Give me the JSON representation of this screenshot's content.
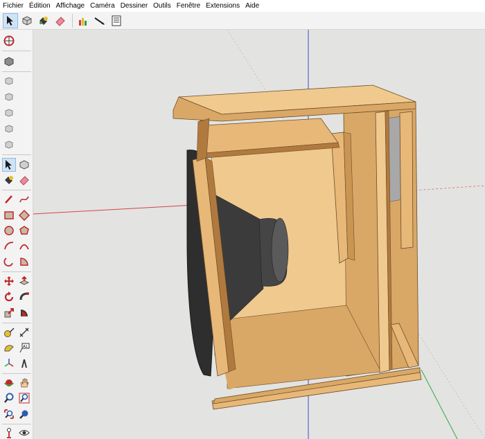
{
  "menu": [
    "Fichier",
    "Édition",
    "Affichage",
    "Caméra",
    "Dessiner",
    "Outils",
    "Fenêtre",
    "Extensions",
    "Aide"
  ],
  "top_toolbar": [
    {
      "icon": "select-arrow-icon",
      "active": true
    },
    {
      "icon": "make-component-icon",
      "active": false
    },
    {
      "icon": "paint-bucket-icon",
      "active": false
    },
    {
      "icon": "eraser-icon",
      "active": false
    },
    {
      "separator": true
    },
    {
      "icon": "warehouse-icon",
      "active": false
    },
    {
      "icon": "section-plane-icon",
      "active": false
    },
    {
      "icon": "model-info-icon",
      "active": false
    }
  ],
  "left_toolbar": [
    {
      "icon": "orbit-globe-icon"
    },
    {
      "icon": "iso-view-icon"
    },
    {
      "icon": "top-view-icon"
    },
    {
      "icon": "front-view-icon"
    },
    {
      "icon": "right-view-icon"
    },
    {
      "icon": "back-view-icon"
    },
    {
      "icon": "left-view-icon"
    },
    {
      "icon": "select-arrow-icon",
      "active": true
    },
    {
      "icon": "make-component-icon"
    },
    {
      "icon": "paint-bucket-icon"
    },
    {
      "icon": "eraser-icon"
    },
    {
      "icon": "line-pencil-icon"
    },
    {
      "icon": "freehand-icon"
    },
    {
      "icon": "rectangle-icon"
    },
    {
      "icon": "rotated-rectangle-icon"
    },
    {
      "icon": "circle-icon"
    },
    {
      "icon": "polygon-icon"
    },
    {
      "icon": "arc-icon"
    },
    {
      "icon": "two-point-arc-icon"
    },
    {
      "icon": "three-point-arc-icon"
    },
    {
      "icon": "pie-icon"
    },
    {
      "icon": "move-icon"
    },
    {
      "icon": "push-pull-icon"
    },
    {
      "icon": "rotate-icon"
    },
    {
      "icon": "follow-me-icon"
    },
    {
      "icon": "scale-icon"
    },
    {
      "icon": "offset-icon"
    },
    {
      "icon": "tape-measure-icon"
    },
    {
      "icon": "dimension-icon"
    },
    {
      "icon": "protractor-icon"
    },
    {
      "icon": "text-label-icon"
    },
    {
      "icon": "axes-icon"
    },
    {
      "icon": "3d-text-icon"
    },
    {
      "icon": "orbit-icon"
    },
    {
      "icon": "pan-hand-icon"
    },
    {
      "icon": "zoom-icon"
    },
    {
      "icon": "zoom-window-icon"
    },
    {
      "icon": "zoom-extents-icon"
    },
    {
      "icon": "previous-view-icon"
    },
    {
      "icon": "position-camera-icon"
    },
    {
      "icon": "look-around-icon"
    }
  ],
  "colors": {
    "wood_light": "#f0c98e",
    "wood_mid": "#d9a866",
    "wood_dark": "#b07a3e",
    "wood_edge": "#e8b878",
    "speaker": "#3b3b3b",
    "axis_red": "#d24545",
    "axis_green": "#2fa84a",
    "axis_blue": "#3b4bd8",
    "viewport_bg": "#e3e3e1"
  }
}
